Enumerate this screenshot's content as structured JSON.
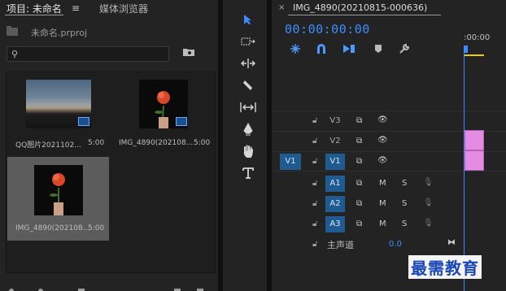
{
  "project_panel": {
    "tabs": [
      {
        "label": "项目: 未命名",
        "active": true
      },
      {
        "label": "媒体浏览器",
        "active": false
      }
    ],
    "menu_icon": "hamburger-icon",
    "project_file": "未命名.prproj",
    "search": {
      "value": "",
      "placeholder": ""
    },
    "clips": [
      {
        "name": "QQ图片2021102...",
        "duration": "5:00",
        "kind": "image-sequence",
        "selected": false
      },
      {
        "name": "IMG_4890(202108...",
        "duration": "5:00",
        "kind": "sequence",
        "selected": false
      },
      {
        "name": "IMG_4890(202108...",
        "duration": "5:00",
        "kind": "image",
        "selected": true
      }
    ]
  },
  "tools": [
    "selection-tool",
    "track-select-tool",
    "ripple-edit-tool",
    "razor-tool",
    "slip-tool",
    "pen-tool",
    "hand-tool",
    "type-tool"
  ],
  "timeline": {
    "sequence_title": "IMG_4890(20210815-000636)",
    "timecode": "00:00:00:00",
    "ruler_time": ":00:00",
    "video_tracks": [
      {
        "target": "V3",
        "source": ""
      },
      {
        "target": "V2",
        "source": ""
      },
      {
        "target": "V1",
        "source": "V1"
      }
    ],
    "audio_tracks": [
      {
        "target": "A1",
        "mute": "M",
        "solo": "S"
      },
      {
        "target": "A2",
        "mute": "M",
        "solo": "S"
      },
      {
        "target": "A3",
        "mute": "M",
        "solo": "S"
      }
    ],
    "master": {
      "label": "主声道",
      "value": "0.0"
    }
  },
  "watermark": "最需教育",
  "colors": {
    "accent": "#3d8bff",
    "track_patch": "#1f5a91",
    "clip": "#e48be4",
    "playhead_bar": "#e6d100"
  }
}
